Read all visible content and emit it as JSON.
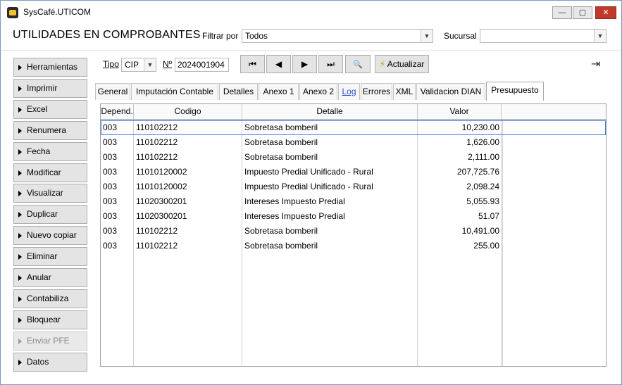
{
  "window": {
    "title": "SysCafé.UTICOM",
    "controls": {
      "minimize": "—",
      "maximize": "▢",
      "close": "✕"
    }
  },
  "header": {
    "page_title": "UTILIDADES EN COMPROBANTES",
    "filter_label": "Filtrar por",
    "filter_value": "Todos",
    "branch_label": "Sucursal",
    "branch_value": ""
  },
  "toolbar": {
    "tipo_label": "Tipo",
    "tipo_value": "CIP",
    "number_label": "Nº",
    "number_value": "2024001904",
    "first_glyph": "⏮",
    "prev_glyph": "◀",
    "next_glyph": "▶",
    "last_glyph": "⏭",
    "search_glyph": "🔍",
    "refresh_label": "Actualizar",
    "refresh_glyph": "⚡",
    "exit_glyph": "⇥"
  },
  "sidebar": {
    "items": [
      {
        "label": "Herramientas",
        "enabled": true
      },
      {
        "label": "Imprimir",
        "enabled": true
      },
      {
        "label": "Excel",
        "enabled": true
      },
      {
        "label": "Renumera",
        "enabled": true
      },
      {
        "label": "Fecha",
        "enabled": true
      },
      {
        "label": "Modificar",
        "enabled": true
      },
      {
        "label": "Visualizar",
        "enabled": true
      },
      {
        "label": "Duplicar",
        "enabled": true
      },
      {
        "label": "Nuevo copiar",
        "enabled": true
      },
      {
        "label": "Eliminar",
        "enabled": true
      },
      {
        "label": "Anular",
        "enabled": true
      },
      {
        "label": "Contabiliza",
        "enabled": true
      },
      {
        "label": "Bloquear",
        "enabled": true
      },
      {
        "label": "Enviar PFE",
        "enabled": false
      },
      {
        "label": "Datos",
        "enabled": true
      }
    ]
  },
  "tabs": [
    {
      "label": "General"
    },
    {
      "label": "Imputación Contable"
    },
    {
      "label": "Detalles"
    },
    {
      "label": "Anexo 1"
    },
    {
      "label": "Anexo 2"
    },
    {
      "label": "Log"
    },
    {
      "label": "Errores"
    },
    {
      "label": "XML"
    },
    {
      "label": "Validacion DIAN"
    },
    {
      "label": "Presupuesto"
    }
  ],
  "active_tab": "Presupuesto",
  "table": {
    "columns": [
      "Depend.",
      "Codigo",
      "Detalle",
      "Valor"
    ],
    "rows": [
      [
        "003",
        "110102212",
        "Sobretasa bomberil",
        "10,230.00"
      ],
      [
        "003",
        "110102212",
        "Sobretasa bomberil",
        "1,626.00"
      ],
      [
        "003",
        "110102212",
        "Sobretasa bomberil",
        "2,111.00"
      ],
      [
        "003",
        "11010120002",
        "Impuesto Predial Unificado - Rural",
        "207,725.76"
      ],
      [
        "003",
        "11010120002",
        "Impuesto Predial Unificado - Rural",
        "2,098.24"
      ],
      [
        "003",
        "11020300201",
        "Intereses Impuesto Predial",
        "5,055.93"
      ],
      [
        "003",
        "11020300201",
        "Intereses Impuesto Predial",
        "51.07"
      ],
      [
        "003",
        "110102212",
        "Sobretasa bomberil",
        "10,491.00"
      ],
      [
        "003",
        "110102212",
        "Sobretasa bomberil",
        "255.00"
      ]
    ]
  }
}
